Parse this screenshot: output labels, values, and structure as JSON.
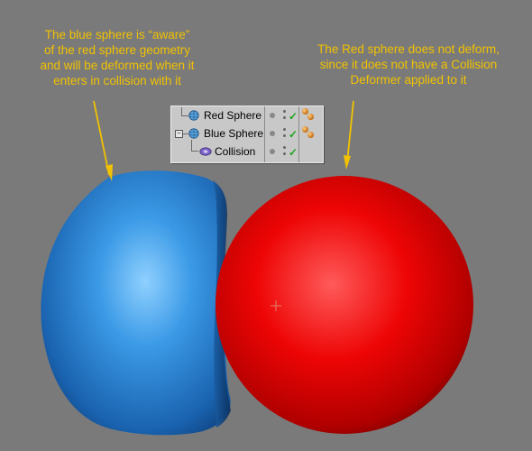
{
  "annotations": {
    "left": {
      "line1": "The blue sphere is “aware”",
      "line2": "of the red sphere geometry",
      "line3": "and will be deformed when it",
      "line4": "enters in collision with it"
    },
    "right": {
      "line1": "The Red sphere does not deform,",
      "line2": "since it does not have a Collision",
      "line3": "Deformer applied to it"
    }
  },
  "object_manager": {
    "items": [
      {
        "label": "Red Sphere",
        "icon": "sphere-icon"
      },
      {
        "label": "Blue Sphere",
        "icon": "sphere-icon",
        "expanded": true
      },
      {
        "label": "Collision",
        "icon": "collision-deformer-icon"
      }
    ]
  },
  "colors": {
    "background": "#7a7a7a",
    "annotation_text": "#f2c200",
    "blue_sphere": "#2f8fe0",
    "red_sphere": "#e60000",
    "checkmark": "#1ea31e"
  }
}
